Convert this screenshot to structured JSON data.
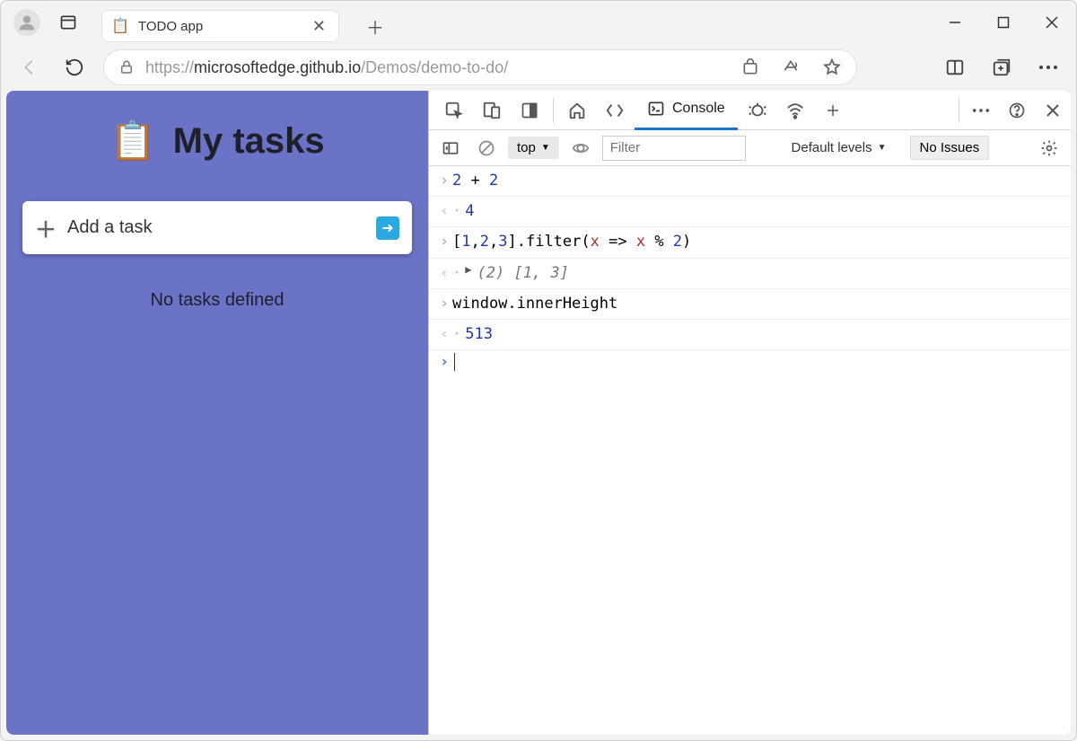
{
  "tab": {
    "title": "TODO app"
  },
  "url": {
    "gray1": "https://",
    "dark": "microsoftedge.github.io",
    "gray2": "/Demos/demo-to-do/"
  },
  "todo": {
    "title": "My tasks",
    "add": "Add a task",
    "empty": "No tasks defined"
  },
  "devtools": {
    "console_tab": "Console",
    "top": "top",
    "filter_placeholder": "Filter",
    "levels": "Default levels",
    "no_issues": "No Issues",
    "lines": [
      {
        "type": "in",
        "html": "<span class='num'>2</span> + <span class='num'>2</span>"
      },
      {
        "type": "out",
        "html": "<span class='num'>4</span>"
      },
      {
        "type": "in",
        "html": "[<span class='num'>1</span>,<span class='num'>2</span>,<span class='num'>3</span>].filter(<span class='arr'>x</span> =&gt; <span class='arr'>x</span> % <span class='num'>2</span>)"
      },
      {
        "type": "out",
        "expand": true,
        "html": "<span class='gray'>(2)</span> <span class='gray'>[1, 3]</span>"
      },
      {
        "type": "in",
        "html": "window.innerHeight"
      },
      {
        "type": "out",
        "html": "<span class='num'>513</span>"
      }
    ]
  }
}
